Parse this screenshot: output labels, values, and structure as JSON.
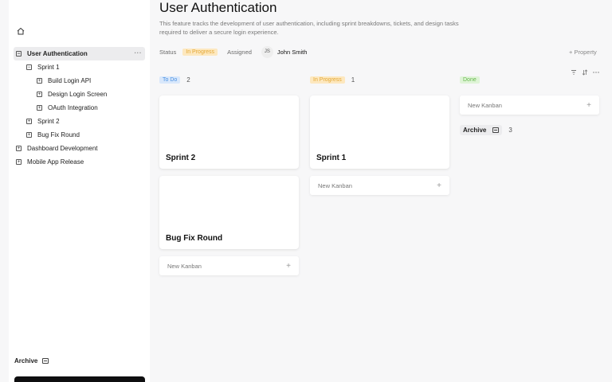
{
  "page": {
    "title": "User Authentication",
    "description": "This feature tracks the development of user authentication, including sprint breakdowns, tickets, and design tasks required to deliver a secure login experience."
  },
  "properties": {
    "status_label": "Status",
    "status_value": "In Progress",
    "assigned_label": "Assigned",
    "assignee_initials": "JS",
    "assignee_name": "John Smith",
    "add_property": "+ Property"
  },
  "sidebar": {
    "home_icon": "home-icon",
    "tree": [
      {
        "label": "User Authentication",
        "indent": 0,
        "toggle": "−",
        "active": true
      },
      {
        "label": "Sprint 1",
        "indent": 1,
        "toggle": "−"
      },
      {
        "label": "Build Login API",
        "indent": 2,
        "toggle": "+"
      },
      {
        "label": "Design Login Screen",
        "indent": 2,
        "toggle": "+"
      },
      {
        "label": "OAuth Integration",
        "indent": 2,
        "toggle": "+"
      },
      {
        "label": "Sprint 2",
        "indent": 1,
        "toggle": "+"
      },
      {
        "label": "Bug Fix Round",
        "indent": 1,
        "toggle": "+"
      },
      {
        "label": "Dashboard Development",
        "indent": 0,
        "toggle": "+"
      },
      {
        "label": "Mobile App Release",
        "indent": 0,
        "toggle": "+"
      }
    ],
    "archive_label": "Archive"
  },
  "board": {
    "columns": [
      {
        "name": "To Do",
        "count": "2",
        "cards": [
          "Sprint 2",
          "Bug Fix Round"
        ],
        "new_label": "New Kanban"
      },
      {
        "name": "In Progress",
        "count": "1",
        "cards": [
          "Sprint 1"
        ],
        "new_label": "New Kanban"
      },
      {
        "name": "Done",
        "count": "",
        "cards": [],
        "new_label": "New Kanban",
        "archive_label": "Archive",
        "archive_count": "3"
      }
    ],
    "tools": {
      "filter_icon": "filter-icon",
      "sort_icon": "sort-icon",
      "more_icon": "more-icon"
    }
  },
  "colors": {
    "todo": "#4a90e2",
    "in_progress": "#e3a735",
    "done": "#66b84e"
  }
}
